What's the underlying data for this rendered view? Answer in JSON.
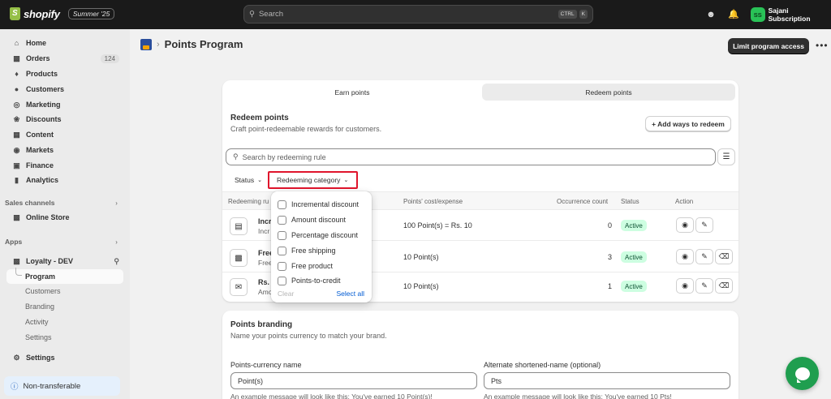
{
  "topbar": {
    "brand": "shopify",
    "edition": "Summer '25",
    "search_placeholder": "Search",
    "shortcut_keys": [
      "CTRL",
      "K"
    ],
    "store_initials": "SS",
    "store_name": "Sajani Subscription"
  },
  "sidebar": {
    "nav": [
      {
        "label": "Home",
        "icon": "house-icon"
      },
      {
        "label": "Orders",
        "icon": "inbox-icon",
        "count": "124"
      },
      {
        "label": "Products",
        "icon": "tag-icon"
      },
      {
        "label": "Customers",
        "icon": "person-icon"
      },
      {
        "label": "Marketing",
        "icon": "target-icon"
      },
      {
        "label": "Discounts",
        "icon": "discount-icon"
      },
      {
        "label": "Content",
        "icon": "content-icon"
      },
      {
        "label": "Markets",
        "icon": "globe-icon"
      },
      {
        "label": "Finance",
        "icon": "bank-icon"
      },
      {
        "label": "Analytics",
        "icon": "bar-chart-icon"
      }
    ],
    "sales_channels_label": "Sales channels",
    "online_store": "Online Store",
    "apps_label": "Apps",
    "app_name": "Loyalty - DEV",
    "app_sub": [
      "Program",
      "Customers",
      "Branding",
      "Activity",
      "Settings"
    ],
    "settings": "Settings",
    "non_transferable": "Non-transferable"
  },
  "header": {
    "title": "Points Program",
    "limit_button": "Limit program access",
    "more": "•••"
  },
  "redeem_card": {
    "tabs": [
      "Earn points",
      "Redeem points"
    ],
    "active_tab": "Redeem points",
    "title": "Redeem points",
    "description": "Craft point-redeemable rewards for customers.",
    "add_button": "+ Add ways to redeem",
    "search_placeholder": "Search by redeeming rule",
    "filters": {
      "status": "Status",
      "category": "Redeeming category"
    },
    "columns": {
      "rule": "Redeeming ru",
      "cost": "Points' cost/expense",
      "occurrence": "Occurrence count",
      "status": "Status",
      "action": "Action"
    },
    "rows": [
      {
        "name": "Incr",
        "desc": "Incr",
        "cost": "100 Point(s) = Rs. 10",
        "occurrence": "0",
        "status": "Active",
        "icon": "cash-icon",
        "deletable": false
      },
      {
        "name": "Free",
        "desc": "Free",
        "cost": "10 Point(s)",
        "occurrence": "3",
        "status": "Active",
        "icon": "gift-box-icon",
        "deletable": true
      },
      {
        "name": "Rs.",
        "desc": "Amo",
        "cost": "10 Point(s)",
        "occurrence": "1",
        "status": "Active",
        "icon": "envelope-icon",
        "deletable": true
      }
    ]
  },
  "category_dropdown": {
    "options": [
      "Incremental discount",
      "Amount discount",
      "Percentage discount",
      "Free shipping",
      "Free product",
      "Points-to-credit"
    ],
    "clear": "Clear",
    "select_all": "Select all"
  },
  "branding_card": {
    "title": "Points branding",
    "description": "Name your points currency to match your brand.",
    "currency_label": "Points-currency name",
    "currency_value": "Point(s)",
    "currency_help": "An example message will look like this: You've earned 10 Point(s)!",
    "short_label": "Alternate shortened-name (optional)",
    "short_value": "Pts",
    "short_help": "An example message will look like this: You've earned 10 Pts!"
  },
  "colors": {
    "accent": "#1a1a1a",
    "active_badge": "#cdfee1",
    "highlight": "#e0152c",
    "chat": "#1f9e4f"
  }
}
